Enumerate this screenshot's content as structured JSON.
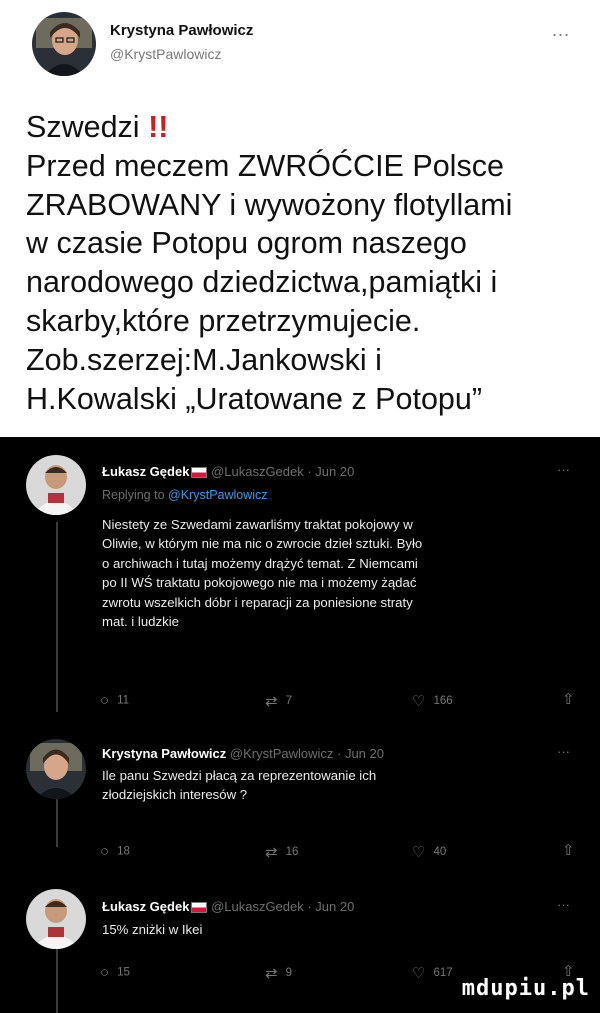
{
  "main_tweet": {
    "author_name": "Krystyna Pawłowicz",
    "author_handle": "@KrystPawlowicz",
    "more": "...",
    "headline": "Szwedzi",
    "exclamation": "!!",
    "lines": [
      "Przed meczem ZWRÓĆCIE Polsce",
      "ZRABOWANY i wywożony flotyllami",
      "w czasie Potopu ogrom naszego",
      "narodowego dziedzictwa,pamiątki i",
      "skarby,które przetrzymujecie.",
      "Zob.szerzej:M.Jankowski i",
      "H.Kowalski „Uratowane z Potopu”"
    ]
  },
  "replies": [
    {
      "author_name": "Łukasz Gędek",
      "meta": "@LukaszGedek · Jun 20",
      "more": "···",
      "replying_prefix": "Replying to",
      "replying_to": "@KrystPawlowicz",
      "lines": [
        "Niestety ze Szwedami zawarliśmy traktat pokojowy w",
        "Oliwie, w którym nie ma nic o zwrocie dzieł sztuki. Było",
        "o archiwach i tutaj możemy drążyć temat. Z Niemcami",
        "po II WŚ traktatu pokojowego nie ma i możemy żądać",
        "zwrotu wszelkich dóbr i reparacji za poniesione straty",
        "mat. i ludzkie"
      ],
      "counts": {
        "replies": "11",
        "retweets": "7",
        "likes": "166"
      }
    },
    {
      "author_name": "Krystyna Pawłowicz",
      "meta": "@KrystPawlowicz · Jun 20",
      "more": "···",
      "lines": [
        "Ile panu Szwedzi płacą za reprezentowanie ich",
        "złodziejskich interesów ?"
      ],
      "counts": {
        "replies": "18",
        "retweets": "16",
        "likes": "40"
      }
    },
    {
      "author_name": "Łukasz Gędek",
      "meta": "@LukaszGedek · Jun 20",
      "more": "···",
      "lines": [
        "15% zniżki w Ikei"
      ],
      "counts": {
        "replies": "15",
        "retweets": "9",
        "likes": "617"
      }
    }
  ],
  "icons": {
    "reply": "○",
    "retweet": "⇄",
    "like": "♡",
    "share": "⇧"
  },
  "watermark": "mdupiu.pl",
  "colors": {
    "link": "#3f9ae6",
    "alert": "#d01d1d",
    "dark_bg": "#000000"
  }
}
